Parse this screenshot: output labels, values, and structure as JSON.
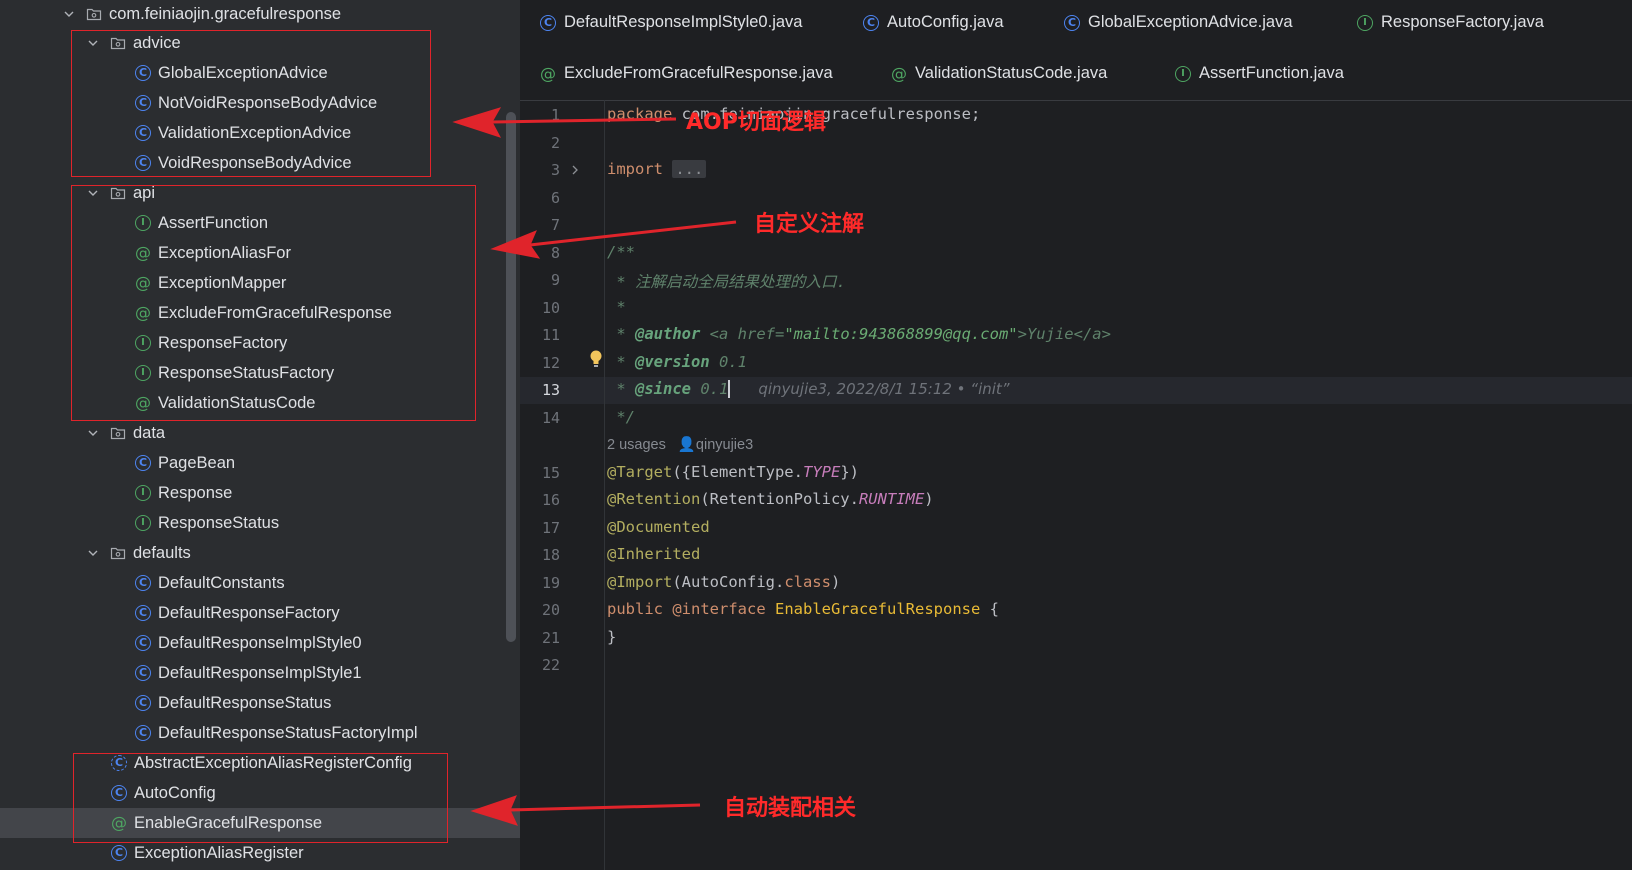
{
  "tree": {
    "root": "com.feiniaojin.gracefulresponse",
    "packages": {
      "advice": "advice",
      "api": "api",
      "data": "data",
      "defaults": "defaults"
    },
    "advice_items": [
      "GlobalExceptionAdvice",
      "NotVoidResponseBodyAdvice",
      "ValidationExceptionAdvice",
      "VoidResponseBodyAdvice"
    ],
    "api_items": [
      "AssertFunction",
      "ExceptionAliasFor",
      "ExceptionMapper",
      "ExcludeFromGracefulResponse",
      "ResponseFactory",
      "ResponseStatusFactory",
      "ValidationStatusCode"
    ],
    "data_items": [
      "PageBean",
      "Response",
      "ResponseStatus"
    ],
    "defaults_items": [
      "DefaultConstants",
      "DefaultResponseFactory",
      "DefaultResponseImplStyle0",
      "DefaultResponseImplStyle1",
      "DefaultResponseStatus",
      "DefaultResponseStatusFactoryImpl"
    ],
    "root_items": [
      "AbstractExceptionAliasRegisterConfig",
      "AutoConfig",
      "EnableGracefulResponse",
      "ExceptionAliasRegister"
    ]
  },
  "tabs": {
    "row1": [
      "DefaultResponseImplStyle0.java",
      "AutoConfig.java",
      "GlobalExceptionAdvice.java",
      "ResponseFactory.java"
    ],
    "row2": [
      "ExcludeFromGracefulResponse.java",
      "ValidationStatusCode.java",
      "AssertFunction.java"
    ]
  },
  "code": {
    "line_numbers": [
      "1",
      "2",
      "3",
      "6",
      "7",
      "8",
      "9",
      "10",
      "11",
      "12",
      "13",
      "14",
      "15",
      "16",
      "17",
      "18",
      "19",
      "20",
      "21",
      "22"
    ],
    "package_kw": "package",
    "package_name": " com.feiniaojin.gracefulresponse;",
    "import_kw": "import",
    "import_fold": "...",
    "doc_open": "/**",
    "doc_line1": " * 注解启动全局结果处理的入口.",
    "doc_line2": " *",
    "author_prefix": " * ",
    "author_tag": "@author",
    "author_html_open": " <a href=",
    "author_href": "\"mailto:943868899@qq.com\"",
    "author_gt": ">",
    "author_name": "Yujie",
    "author_html_close": "</a>",
    "version_prefix": " * ",
    "version_tag": "@version",
    "version_value": " 0.1",
    "since_prefix": " * ",
    "since_tag": "@since",
    "since_value": " 0.1",
    "blame": "qinyujie3, 2022/8/1 15:12 • “init”",
    "doc_close": " */",
    "usages": "2 usages",
    "author_hint": "qinyujie3",
    "target_ann": "@Target",
    "target_open": "({ElementType.",
    "target_const": "TYPE",
    "target_close": "})",
    "retention_ann": "@Retention",
    "retention_open": "(RetentionPolicy.",
    "retention_const": "RUNTIME",
    "retention_close": ")",
    "documented_ann": "@Documented",
    "inherited_ann": "@Inherited",
    "import_ann": "@Import",
    "import_open": "(AutoConfig.",
    "import_class_kw": "class",
    "import_close": ")",
    "public_kw": "public",
    "interface_kw": "@interface",
    "interface_name": "EnableGracefulResponse",
    "interface_open": " {",
    "interface_close": "}"
  },
  "annotations": {
    "aop": "AOP切面逻辑",
    "custom_annotation": "自定义注解",
    "auto_config": "自动装配相关"
  },
  "colors": {
    "annotation_red": "#e0242b",
    "class_icon": "#4d84f0",
    "interface_icon": "#4ea562"
  }
}
